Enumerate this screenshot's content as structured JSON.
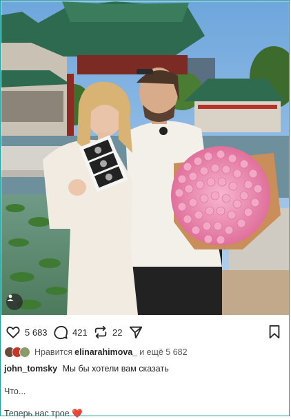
{
  "post": {
    "image_alt": "",
    "actions": {
      "like_count": "5 683",
      "comment_count": "421",
      "repost_count": "22"
    },
    "likes": {
      "prefix": "Нравится",
      "user": "elinarahimova_",
      "suffix": "и ещё 5 682"
    },
    "caption": {
      "username": "john_tomsky",
      "line1": "Мы бы хотели вам сказать",
      "line2": "Что...",
      "line3": "Теперь нас трое ❤️"
    }
  },
  "icons": {
    "like": "heart-icon",
    "comment": "comment-bubble-icon",
    "repost": "repost-icon",
    "share": "send-paper-plane-icon",
    "save": "bookmark-icon",
    "tagged_users": "person-icon"
  },
  "colors": {
    "border": "#1fa0a0",
    "text": "#262626",
    "muted": "#555555"
  }
}
